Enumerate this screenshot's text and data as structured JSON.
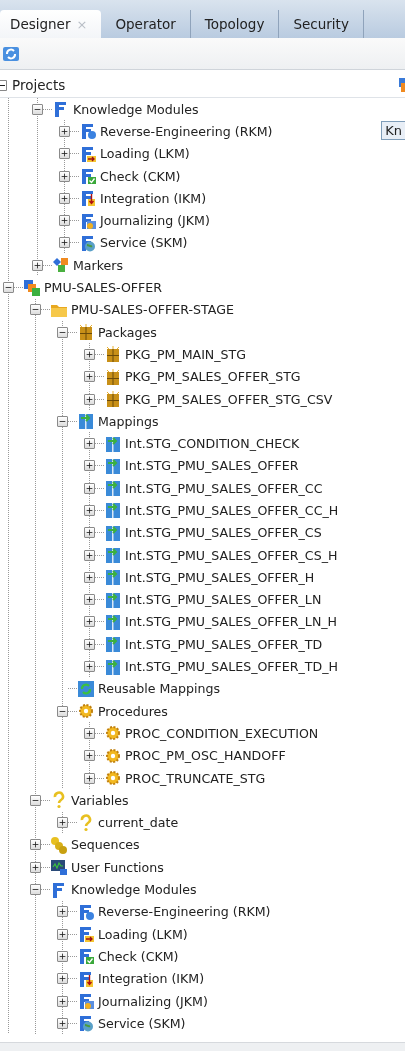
{
  "tabs": [
    {
      "label": "Designer",
      "selected": true,
      "close": "×"
    },
    {
      "label": "Operator",
      "selected": false
    },
    {
      "label": "Topology",
      "selected": false
    },
    {
      "label": "Security",
      "selected": false
    }
  ],
  "panel": {
    "title": "Projects",
    "expanded": true,
    "tooltip": "Kn"
  },
  "tree": {
    "partial_parent_children": [
      {
        "label": "Knowledge Modules",
        "kind": "km",
        "expanded": true,
        "children": [
          {
            "label": "Reverse-Engineering (RKM)",
            "kind": "rkm",
            "expanded": false
          },
          {
            "label": "Loading (LKM)",
            "kind": "lkm",
            "expanded": false
          },
          {
            "label": "Check (CKM)",
            "kind": "ckm",
            "expanded": false
          },
          {
            "label": "Integration (IKM)",
            "kind": "ikm",
            "expanded": false
          },
          {
            "label": "Journalizing (JKM)",
            "kind": "jkm",
            "expanded": false
          },
          {
            "label": "Service (SKM)",
            "kind": "skm",
            "expanded": false
          }
        ]
      },
      {
        "label": "Markers",
        "kind": "markers",
        "expanded": false
      }
    ],
    "nodes": [
      {
        "label": "PMU-SALES-OFFER",
        "kind": "project",
        "expanded": true,
        "children": [
          {
            "label": "PMU-SALES-OFFER-STAGE",
            "kind": "folder",
            "expanded": true,
            "children": [
              {
                "label": "Packages",
                "kind": "packages",
                "expanded": true,
                "children": [
                  {
                    "label": "PKG_PM_MAIN_STG",
                    "kind": "package",
                    "expanded": false
                  },
                  {
                    "label": "PKG_PM_SALES_OFFER_STG",
                    "kind": "package",
                    "expanded": false
                  },
                  {
                    "label": "PKG_PM_SALES_OFFER_STG_CSV",
                    "kind": "package",
                    "expanded": false
                  }
                ]
              },
              {
                "label": "Mappings",
                "kind": "mappings",
                "expanded": true,
                "children": [
                  {
                    "label": "Int.STG_CONDITION_CHECK",
                    "kind": "mapping",
                    "expanded": false
                  },
                  {
                    "label": "Int.STG_PMU_SALES_OFFER",
                    "kind": "mapping",
                    "expanded": false
                  },
                  {
                    "label": "Int.STG_PMU_SALES_OFFER_CC",
                    "kind": "mapping",
                    "expanded": false
                  },
                  {
                    "label": "Int.STG_PMU_SALES_OFFER_CC_H",
                    "kind": "mapping",
                    "expanded": false
                  },
                  {
                    "label": "Int.STG_PMU_SALES_OFFER_CS",
                    "kind": "mapping",
                    "expanded": false
                  },
                  {
                    "label": "Int.STG_PMU_SALES_OFFER_CS_H",
                    "kind": "mapping",
                    "expanded": false
                  },
                  {
                    "label": "Int.STG_PMU_SALES_OFFER_H",
                    "kind": "mapping",
                    "expanded": false
                  },
                  {
                    "label": "Int.STG_PMU_SALES_OFFER_LN",
                    "kind": "mapping",
                    "expanded": false
                  },
                  {
                    "label": "Int.STG_PMU_SALES_OFFER_LN_H",
                    "kind": "mapping",
                    "expanded": false
                  },
                  {
                    "label": "Int.STG_PMU_SALES_OFFER_TD",
                    "kind": "mapping",
                    "expanded": false
                  },
                  {
                    "label": "Int.STG_PMU_SALES_OFFER_TD_H",
                    "kind": "mapping",
                    "expanded": false
                  }
                ]
              },
              {
                "label": "Reusable Mappings",
                "kind": "reusable"
              },
              {
                "label": "Procedures",
                "kind": "procedures",
                "expanded": true,
                "children": [
                  {
                    "label": "PROC_CONDITION_EXECUTION",
                    "kind": "procedure",
                    "expanded": false
                  },
                  {
                    "label": "PROC_PM_OSC_HANDOFF",
                    "kind": "procedure",
                    "expanded": false
                  },
                  {
                    "label": "PROC_TRUNCATE_STG",
                    "kind": "procedure",
                    "expanded": false
                  }
                ]
              }
            ]
          },
          {
            "label": "Variables",
            "kind": "variables",
            "expanded": true,
            "children": [
              {
                "label": "current_date",
                "kind": "variable",
                "expanded": false
              }
            ]
          },
          {
            "label": "Sequences",
            "kind": "sequences",
            "expanded": false
          },
          {
            "label": "User Functions",
            "kind": "functions",
            "expanded": false
          },
          {
            "label": "Knowledge Modules",
            "kind": "km",
            "expanded": true,
            "children": [
              {
                "label": "Reverse-Engineering (RKM)",
                "kind": "rkm",
                "expanded": false
              },
              {
                "label": "Loading (LKM)",
                "kind": "lkm",
                "expanded": false
              },
              {
                "label": "Check (CKM)",
                "kind": "ckm",
                "expanded": false
              },
              {
                "label": "Integration (IKM)",
                "kind": "ikm",
                "expanded": false
              },
              {
                "label": "Journalizing (JKM)",
                "kind": "jkm",
                "expanded": false
              },
              {
                "label": "Service (SKM)",
                "kind": "skm",
                "expanded": false
              }
            ]
          }
        ]
      }
    ]
  }
}
